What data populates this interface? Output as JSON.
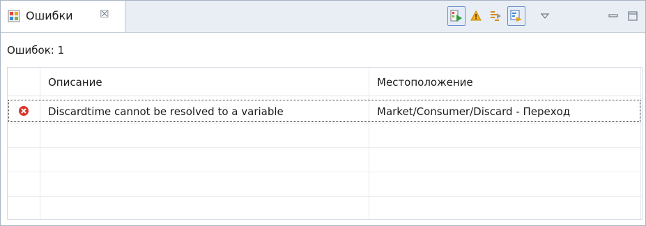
{
  "view": {
    "tab_title": "Ошибки",
    "tab_close_glyph": "☒",
    "toolbar": [
      {
        "name": "run-button-icon",
        "pressed": true
      },
      {
        "name": "warning-icon",
        "pressed": false
      },
      {
        "name": "filter-icon",
        "pressed": false
      },
      {
        "name": "link-with-editor-icon",
        "pressed": true
      },
      {
        "name": "view-menu-icon",
        "pressed": false
      },
      {
        "name": "minimize-icon",
        "pressed": false
      },
      {
        "name": "maximize-icon",
        "pressed": false
      }
    ]
  },
  "summary": "Ошибок: 1",
  "table": {
    "columns": [
      "Описание",
      "Местоположение"
    ],
    "rows": [
      {
        "icon": "error-icon",
        "description": "Discardtime cannot be resolved to a variable",
        "location": "Market/Consumer/Discard - Переход"
      }
    ]
  },
  "colors": {
    "error_red": "#d9342b",
    "warning_orange": "#f0a515",
    "selection_border": "#6c8fc7"
  }
}
